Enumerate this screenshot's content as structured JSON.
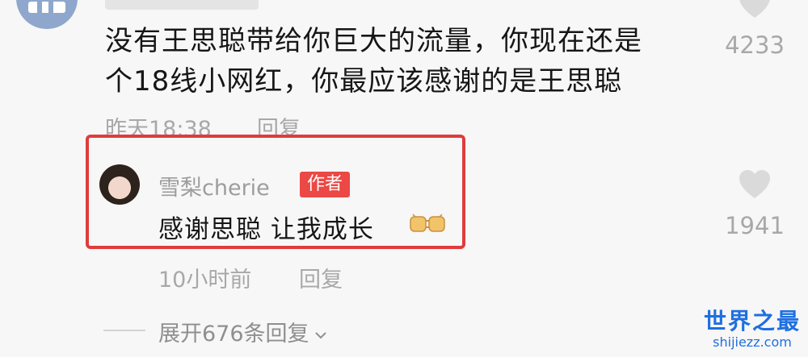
{
  "comment": {
    "text_line1": "没有王思聪带给你巨大的流量，你现在还是",
    "text_line2": "个18线小网红，你最应该感谢的是王思聪",
    "time": "昨天18:38",
    "reply_label": "回复",
    "likes": "4233"
  },
  "reply": {
    "username": "雪梨cherie",
    "badge": "作者",
    "text": "感谢思聪 让我成长",
    "emoji": "fist-bump-icon",
    "time": "10小时前",
    "reply_label": "回复",
    "likes": "1941"
  },
  "expand": {
    "label": "展开676条回复"
  },
  "watermark": {
    "title": "世界之最",
    "domain": "shijiezz.com"
  },
  "colors": {
    "highlight_border": "#e03c3c",
    "badge_bg": "#ec4845",
    "watermark": "#1f6fe0"
  }
}
